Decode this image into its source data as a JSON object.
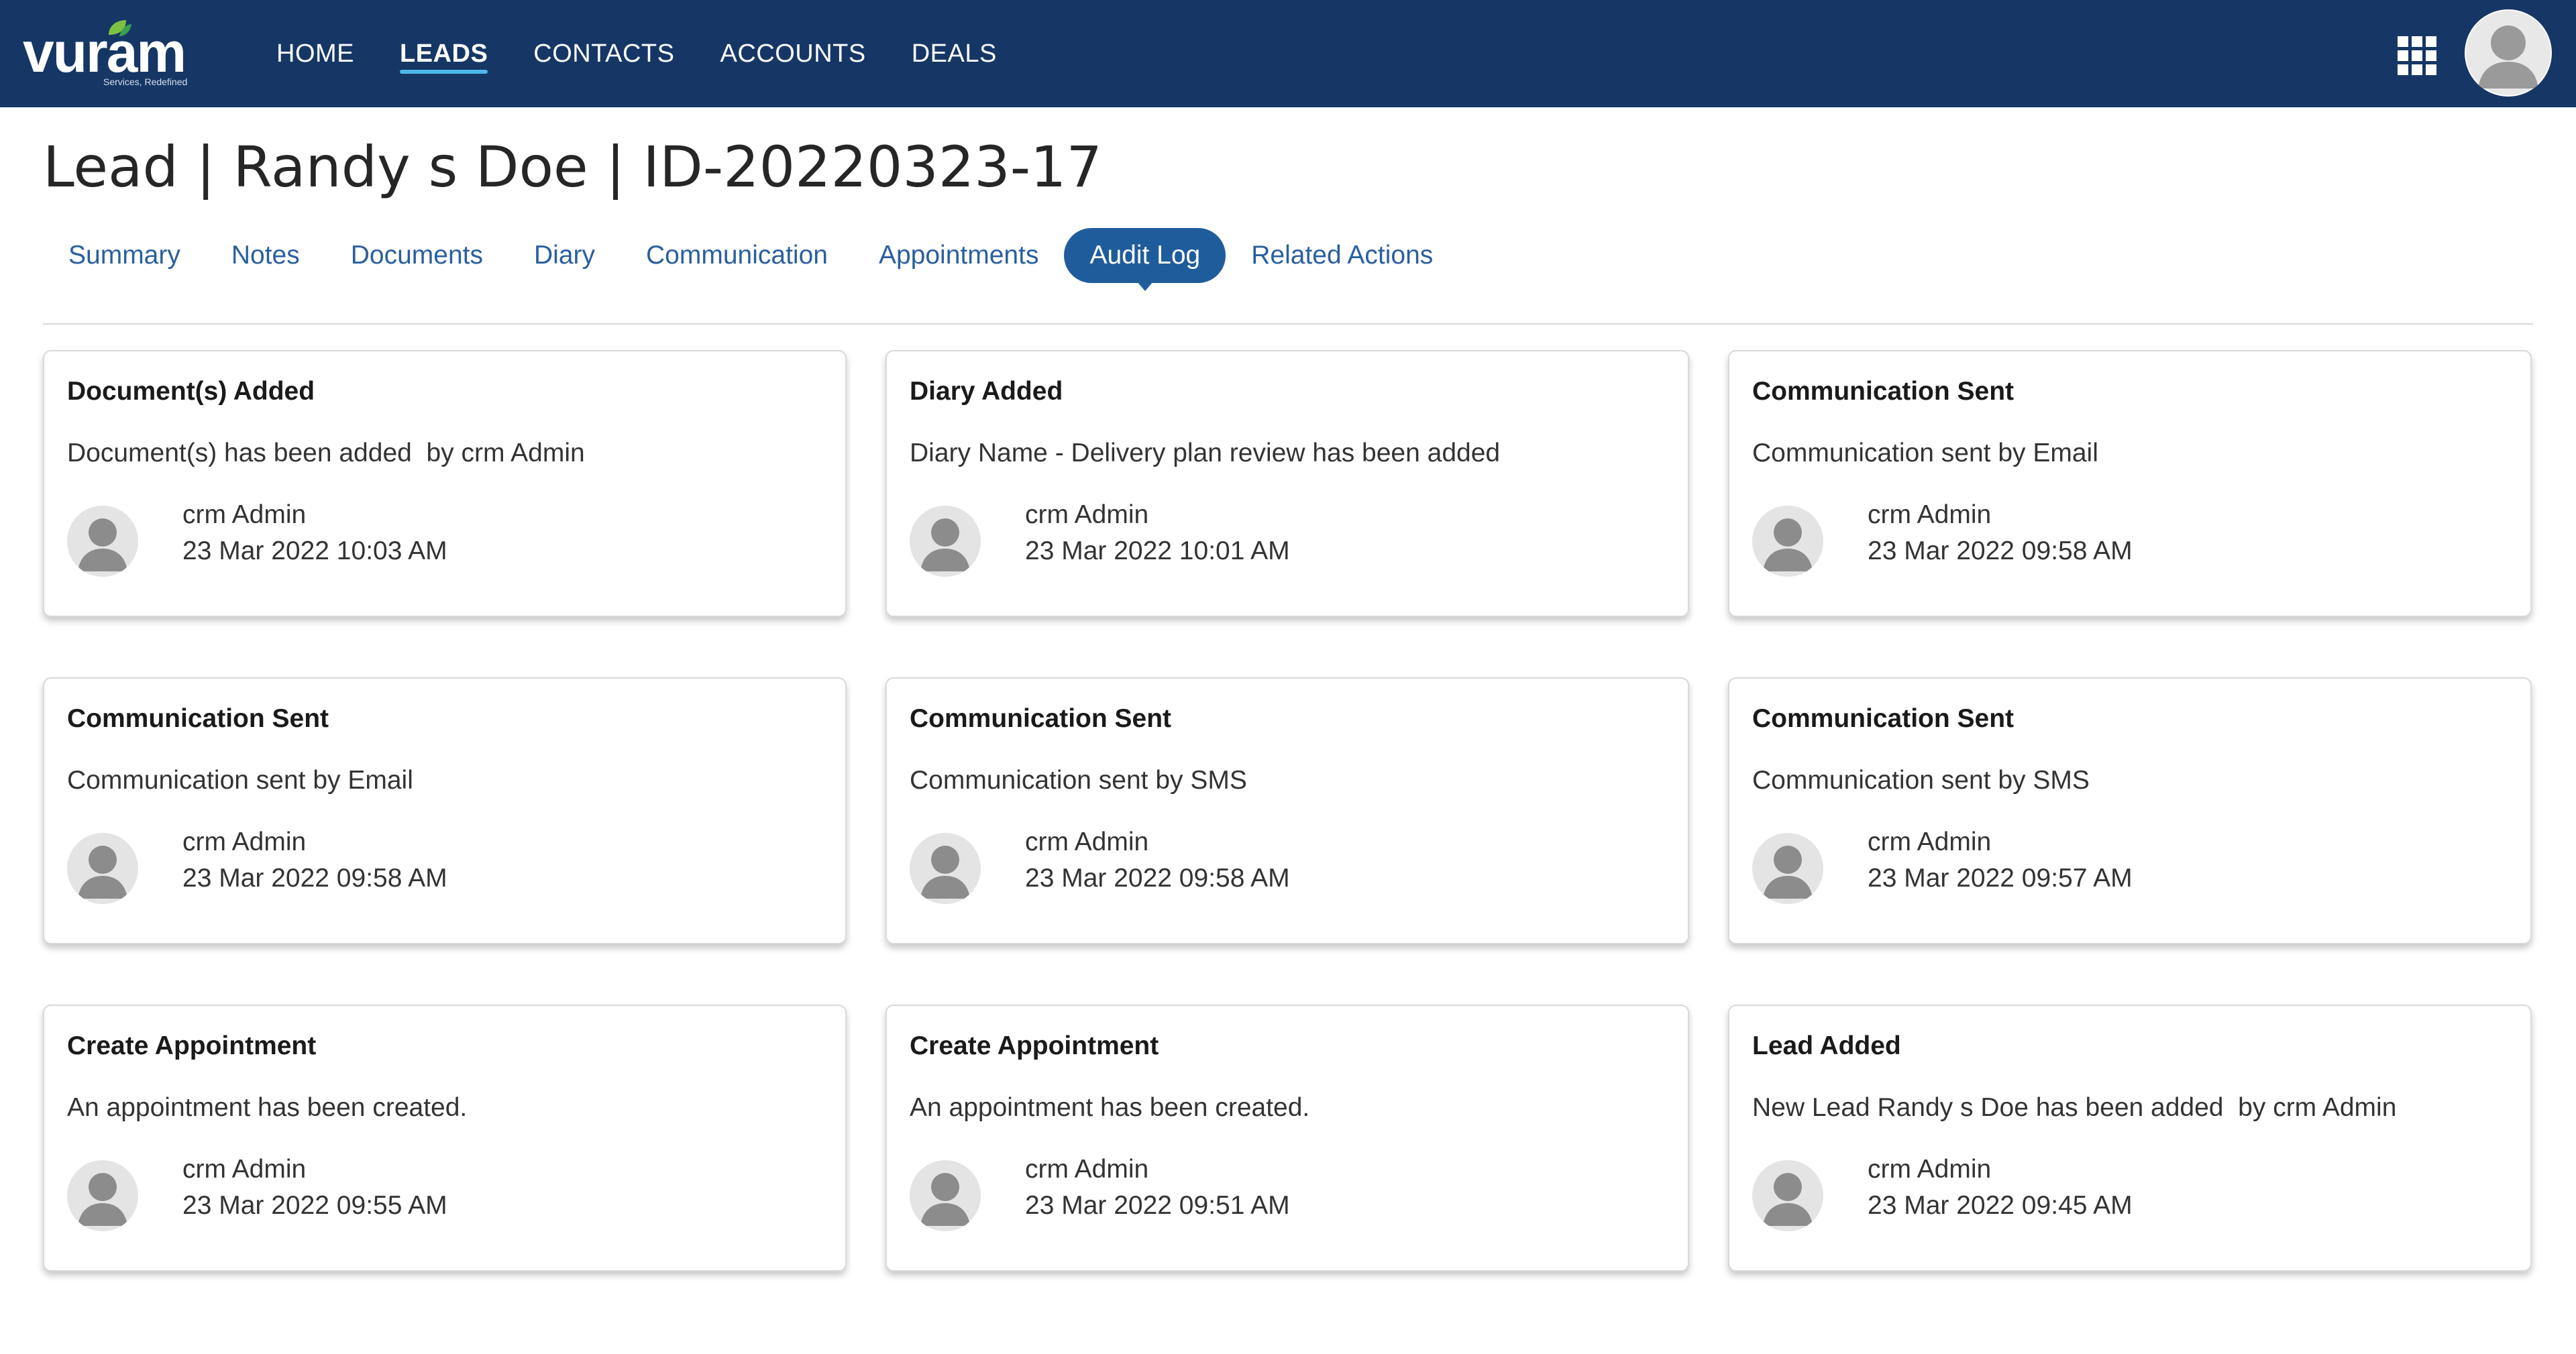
{
  "app": {
    "logo_text": "vuram",
    "logo_tagline": "Services, Redefined"
  },
  "nav": {
    "items": [
      {
        "label": "HOME"
      },
      {
        "label": "LEADS",
        "active": true
      },
      {
        "label": "CONTACTS"
      },
      {
        "label": "ACCOUNTS"
      },
      {
        "label": "DEALS"
      }
    ],
    "apps_icon": "grid-apps-icon",
    "user_icon": "user-avatar-icon"
  },
  "page": {
    "title": "Lead | Randy s Doe | ID-20220323-17"
  },
  "tabs": [
    {
      "label": "Summary"
    },
    {
      "label": "Notes"
    },
    {
      "label": "Documents"
    },
    {
      "label": "Diary"
    },
    {
      "label": "Communication"
    },
    {
      "label": "Appointments"
    },
    {
      "label": "Audit Log",
      "active": true
    },
    {
      "label": "Related Actions"
    }
  ],
  "colors": {
    "topbar": "#163766",
    "active_tab": "#1f5c9c",
    "tab_text": "#2a5f9e",
    "nav_underline": "#4db8e8"
  },
  "audit_log": [
    {
      "title": "Document(s) Added",
      "description": "Document(s) has been added  by crm Admin",
      "user": "crm Admin",
      "timestamp": "23 Mar 2022 10:03 AM"
    },
    {
      "title": "Diary Added",
      "description": "Diary Name - Delivery plan review has been added",
      "user": "crm Admin",
      "timestamp": "23 Mar 2022 10:01 AM"
    },
    {
      "title": "Communication Sent",
      "description": "Communication sent by Email",
      "user": "crm Admin",
      "timestamp": "23 Mar 2022 09:58 AM"
    },
    {
      "title": "Communication Sent",
      "description": "Communication sent by Email",
      "user": "crm Admin",
      "timestamp": "23 Mar 2022 09:58 AM"
    },
    {
      "title": "Communication Sent",
      "description": "Communication sent by SMS",
      "user": "crm Admin",
      "timestamp": "23 Mar 2022 09:58 AM"
    },
    {
      "title": "Communication Sent",
      "description": "Communication sent by SMS",
      "user": "crm Admin",
      "timestamp": "23 Mar 2022 09:57 AM"
    },
    {
      "title": "Create Appointment",
      "description": "An appointment has been created.",
      "user": "crm Admin",
      "timestamp": "23 Mar 2022 09:55 AM"
    },
    {
      "title": "Create Appointment",
      "description": "An appointment has been created.",
      "user": "crm Admin",
      "timestamp": "23 Mar 2022 09:51 AM"
    },
    {
      "title": "Lead Added",
      "description": "New Lead Randy s Doe has been added  by crm Admin",
      "user": "crm Admin",
      "timestamp": "23 Mar 2022 09:45 AM"
    }
  ]
}
